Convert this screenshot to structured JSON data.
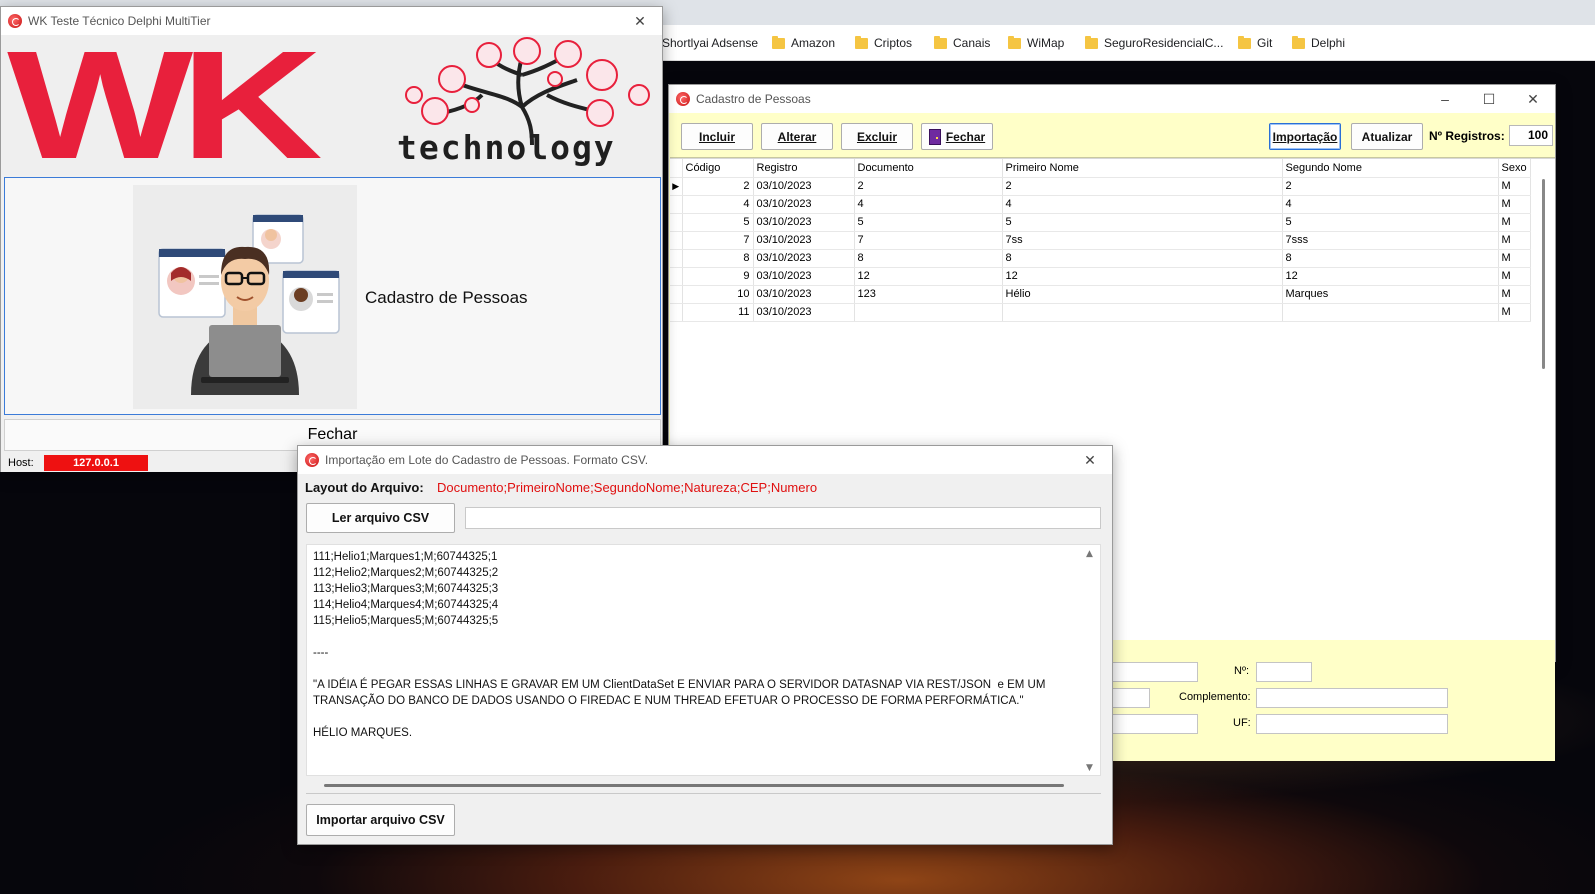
{
  "browser": {
    "bookmarks": [
      {
        "label": "Shortlyai Adsense",
        "folder": false
      },
      {
        "label": "Amazon",
        "folder": true
      },
      {
        "label": "Criptos",
        "folder": true
      },
      {
        "label": "Canais",
        "folder": true
      },
      {
        "label": "WiMap",
        "folder": true
      },
      {
        "label": "SeguroResidencialC...",
        "folder": true
      },
      {
        "label": "Git",
        "folder": true
      },
      {
        "label": "Delphi",
        "folder": true
      }
    ]
  },
  "main_window": {
    "title": "WK Teste Técnico Delphi MultiTier",
    "logo_letters": "WK",
    "logo_word": "technology",
    "tile_label": "Cadastro de Pessoas",
    "close_button": "Fechar",
    "host_label": "Host:",
    "host_value": "127.0.0.1",
    "colors": {
      "logo_red": "#e8203c",
      "host_bg": "#ee1111"
    }
  },
  "cadastro_window": {
    "title": "Cadastro de Pessoas",
    "buttons": {
      "incluir": "Incluir",
      "alterar": "Alterar",
      "excluir": "Excluir",
      "fechar": "Fechar",
      "importacao": "Importação",
      "atualizar": "Atualizar"
    },
    "records_label": "Nº Registros:",
    "records_value": "100",
    "grid": {
      "columns": [
        "Código",
        "Registro",
        "Documento",
        "Primeiro Nome",
        "Segundo Nome",
        "Sexo"
      ],
      "rows": [
        [
          "2",
          "03/10/2023",
          "2",
          "2",
          "2",
          "M"
        ],
        [
          "4",
          "03/10/2023",
          "4",
          "4",
          "4",
          "M"
        ],
        [
          "5",
          "03/10/2023",
          "5",
          "5",
          "5",
          "M"
        ],
        [
          "7",
          "03/10/2023",
          "7",
          "7ss",
          "7sss",
          "M"
        ],
        [
          "8",
          "03/10/2023",
          "8",
          "8",
          "8",
          "M"
        ],
        [
          "9",
          "03/10/2023",
          "12",
          "12",
          "12",
          "M"
        ],
        [
          "10",
          "03/10/2023",
          "123",
          "Hélio",
          "Marques",
          "M"
        ],
        [
          "11",
          "03/10/2023",
          "",
          "",
          "",
          "M"
        ]
      ]
    },
    "form": {
      "numero_label": "Nº:",
      "complemento_label": "Complemento:",
      "uf_label": "UF:"
    },
    "colors": {
      "panel_bg": "#ffffc8"
    }
  },
  "import_window": {
    "title": "Importação em Lote do Cadastro de Pessoas. Formato CSV.",
    "layout_label": "Layout do Arquivo:",
    "layout_value": "Documento;PrimeiroNome;SegundoNome;Natureza;CEP;Numero",
    "read_button": "Ler arquivo CSV",
    "import_button": "Importar arquivo CSV",
    "file_path": "",
    "text_lines": [
      "111;Helio1;Marques1;M;60744325;1",
      "112;Helio2;Marques2;M;60744325;2",
      "113;Helio3;Marques3;M;60744325;3",
      "114;Helio4;Marques4;M;60744325;4",
      "115;Helio5;Marques5;M;60744325;5",
      "",
      "----",
      "",
      "\"A IDÉIA É PEGAR ESSAS LINHAS E GRAVAR EM UM ClientDataSet E ENVIAR PARA O SERVIDOR DATASNAP VIA REST/JSON  e EM UM",
      "TRANSAÇÃO DO BANCO DE DADOS USANDO O FIREDAC E NUM THREAD EFETUAR O PROCESSO DE FORMA PERFORMÁTICA.\"",
      "",
      "HÉLIO MARQUES."
    ],
    "colors": {
      "layout_value": "#e01010"
    }
  }
}
